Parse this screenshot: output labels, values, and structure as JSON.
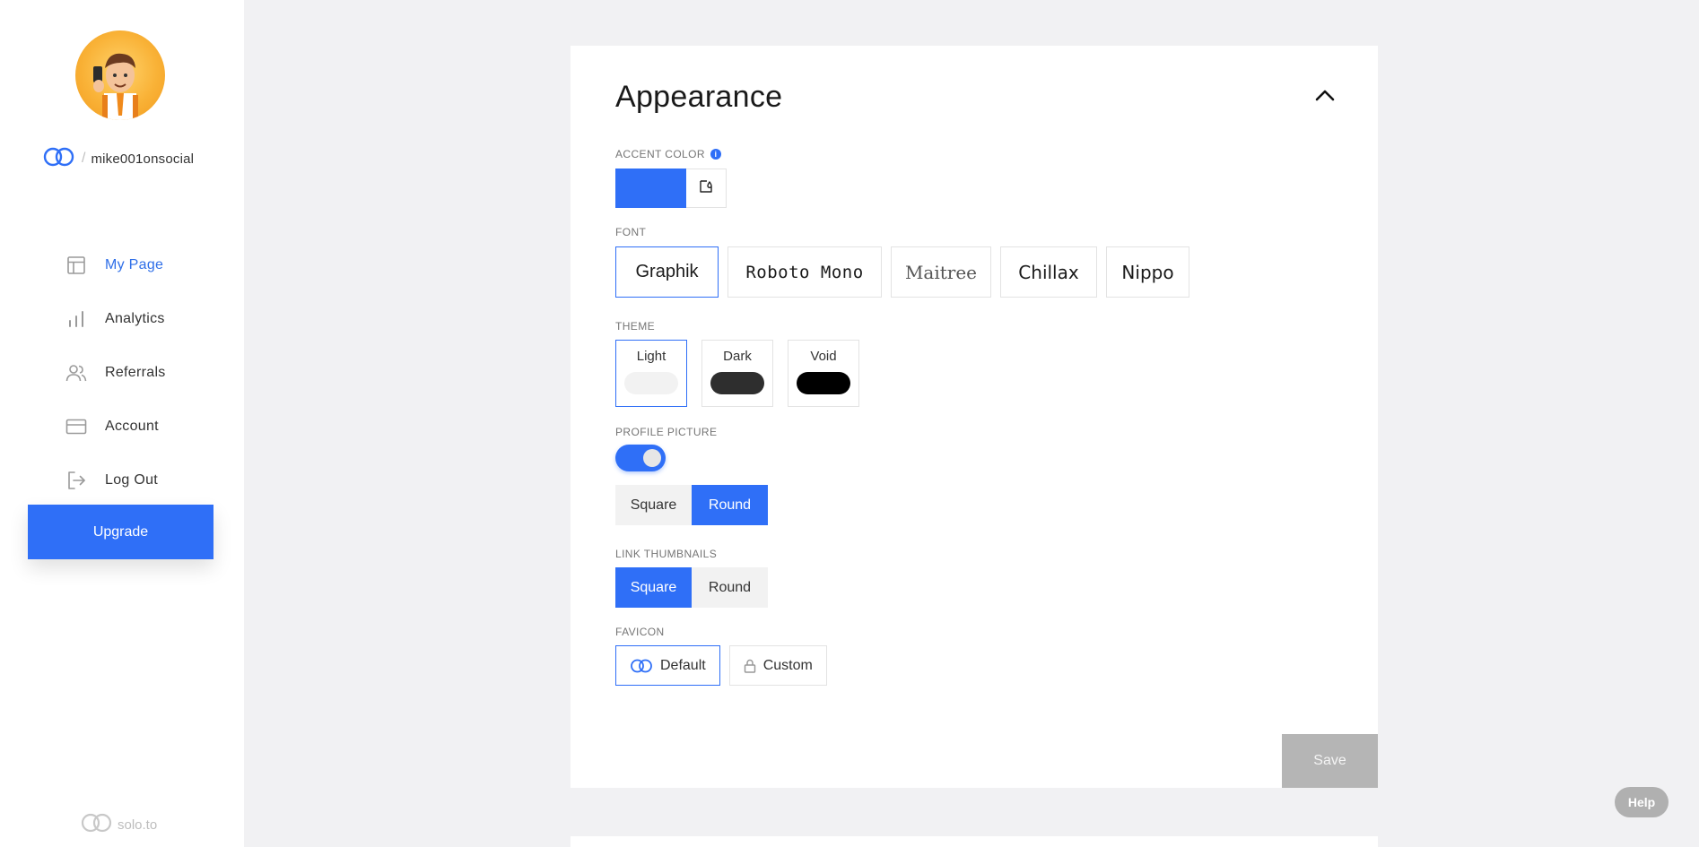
{
  "sidebar": {
    "username": "mike001onsocial",
    "items": [
      {
        "label": "My Page",
        "icon": "layout-icon",
        "active": true
      },
      {
        "label": "Analytics",
        "icon": "bar-chart-icon",
        "active": false
      },
      {
        "label": "Referrals",
        "icon": "users-icon",
        "active": false
      },
      {
        "label": "Account",
        "icon": "credit-card-icon",
        "active": false
      },
      {
        "label": "Log Out",
        "icon": "logout-icon",
        "active": false
      }
    ],
    "upgrade_label": "Upgrade",
    "brand": "solo.to"
  },
  "appearance": {
    "title": "Appearance",
    "accent": {
      "label": "ACCENT COLOR",
      "color": "#2f6ff7"
    },
    "font": {
      "label": "FONT",
      "options": [
        "Graphik",
        "Roboto Mono",
        "Maitree",
        "Chillax",
        "Nippo"
      ],
      "selected": "Graphik"
    },
    "theme": {
      "label": "THEME",
      "options": [
        {
          "name": "Light",
          "color": "#f2f2f2"
        },
        {
          "name": "Dark",
          "color": "#2e2e2e"
        },
        {
          "name": "Void",
          "color": "#000000"
        }
      ],
      "selected": "Light"
    },
    "profile_picture": {
      "label": "PROFILE PICTURE",
      "enabled": true,
      "options": [
        "Square",
        "Round"
      ],
      "selected": "Round"
    },
    "link_thumbnails": {
      "label": "LINK THUMBNAILS",
      "options": [
        "Square",
        "Round"
      ],
      "selected": "Square"
    },
    "favicon": {
      "label": "FAVICON",
      "options": [
        "Default",
        "Custom"
      ],
      "selected": "Default"
    },
    "save_label": "Save"
  },
  "help_label": "Help"
}
